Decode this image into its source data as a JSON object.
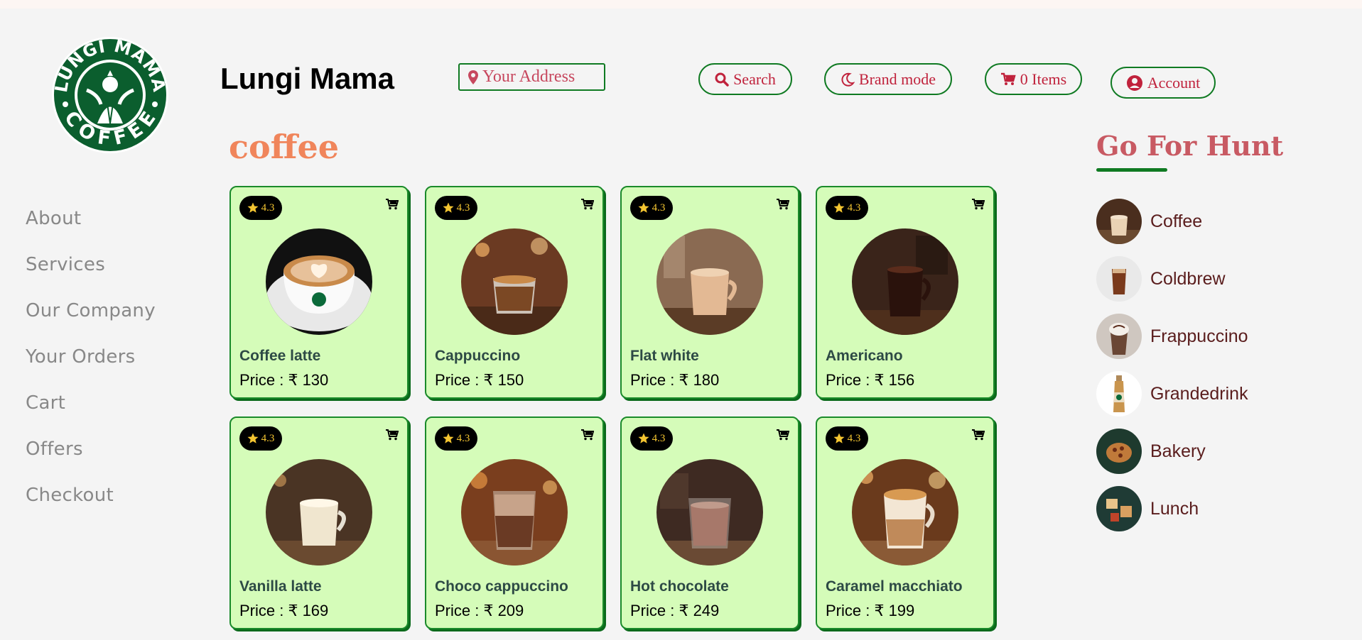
{
  "brand": {
    "name": "Lungi Mama",
    "logo_text_top": "LUNGI MAMA",
    "logo_text_bottom": "COFFEE"
  },
  "sidebar": {
    "items": [
      {
        "label": "About"
      },
      {
        "label": "Services"
      },
      {
        "label": "Our Company"
      },
      {
        "label": "Your Orders"
      },
      {
        "label": "Cart"
      },
      {
        "label": "Offers"
      },
      {
        "label": "Checkout"
      }
    ]
  },
  "header": {
    "address_placeholder": "Your Address",
    "search_label": "Search",
    "brand_mode_label": "Brand mode",
    "cart_label": "0 Items",
    "account_label": "Account"
  },
  "section": {
    "title": "coffee"
  },
  "products": [
    {
      "name": "Coffee latte",
      "price": "Price : ₹ 130",
      "rating": "4.3"
    },
    {
      "name": "Cappuccino",
      "price": "Price : ₹ 150",
      "rating": "4.3"
    },
    {
      "name": "Flat white",
      "price": "Price : ₹ 180",
      "rating": "4.3"
    },
    {
      "name": "Americano",
      "price": "Price : ₹ 156",
      "rating": "4.3"
    },
    {
      "name": "Vanilla latte",
      "price": "Price : ₹ 169",
      "rating": "4.3"
    },
    {
      "name": "Choco cappuccino",
      "price": "Price : ₹ 209",
      "rating": "4.3"
    },
    {
      "name": "Hot chocolate",
      "price": "Price : ₹ 249",
      "rating": "4.3"
    },
    {
      "name": "Caramel macchiato",
      "price": "Price : ₹ 199",
      "rating": "4.3"
    }
  ],
  "hunt": {
    "title": "Go For Hunt",
    "categories": [
      {
        "label": "Coffee"
      },
      {
        "label": "Coldbrew"
      },
      {
        "label": "Frappuccino"
      },
      {
        "label": "Grandedrink"
      },
      {
        "label": "Bakery"
      },
      {
        "label": "Lunch"
      }
    ]
  },
  "colors": {
    "accent_green": "#0f7a22",
    "card_bg": "#d5fcb9",
    "title_orange": "#f0855b",
    "button_text": "#c0223c"
  }
}
